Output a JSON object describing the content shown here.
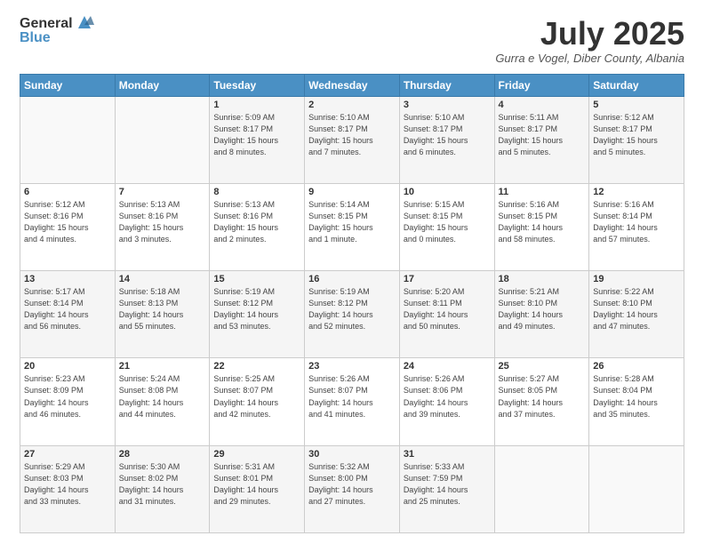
{
  "header": {
    "logo_general": "General",
    "logo_blue": "Blue",
    "month_title": "July 2025",
    "location": "Gurra e Vogel, Diber County, Albania"
  },
  "days_of_week": [
    "Sunday",
    "Monday",
    "Tuesday",
    "Wednesday",
    "Thursday",
    "Friday",
    "Saturday"
  ],
  "weeks": [
    [
      {
        "day": "",
        "info": ""
      },
      {
        "day": "",
        "info": ""
      },
      {
        "day": "1",
        "info": "Sunrise: 5:09 AM\nSunset: 8:17 PM\nDaylight: 15 hours\nand 8 minutes."
      },
      {
        "day": "2",
        "info": "Sunrise: 5:10 AM\nSunset: 8:17 PM\nDaylight: 15 hours\nand 7 minutes."
      },
      {
        "day": "3",
        "info": "Sunrise: 5:10 AM\nSunset: 8:17 PM\nDaylight: 15 hours\nand 6 minutes."
      },
      {
        "day": "4",
        "info": "Sunrise: 5:11 AM\nSunset: 8:17 PM\nDaylight: 15 hours\nand 5 minutes."
      },
      {
        "day": "5",
        "info": "Sunrise: 5:12 AM\nSunset: 8:17 PM\nDaylight: 15 hours\nand 5 minutes."
      }
    ],
    [
      {
        "day": "6",
        "info": "Sunrise: 5:12 AM\nSunset: 8:16 PM\nDaylight: 15 hours\nand 4 minutes."
      },
      {
        "day": "7",
        "info": "Sunrise: 5:13 AM\nSunset: 8:16 PM\nDaylight: 15 hours\nand 3 minutes."
      },
      {
        "day": "8",
        "info": "Sunrise: 5:13 AM\nSunset: 8:16 PM\nDaylight: 15 hours\nand 2 minutes."
      },
      {
        "day": "9",
        "info": "Sunrise: 5:14 AM\nSunset: 8:15 PM\nDaylight: 15 hours\nand 1 minute."
      },
      {
        "day": "10",
        "info": "Sunrise: 5:15 AM\nSunset: 8:15 PM\nDaylight: 15 hours\nand 0 minutes."
      },
      {
        "day": "11",
        "info": "Sunrise: 5:16 AM\nSunset: 8:15 PM\nDaylight: 14 hours\nand 58 minutes."
      },
      {
        "day": "12",
        "info": "Sunrise: 5:16 AM\nSunset: 8:14 PM\nDaylight: 14 hours\nand 57 minutes."
      }
    ],
    [
      {
        "day": "13",
        "info": "Sunrise: 5:17 AM\nSunset: 8:14 PM\nDaylight: 14 hours\nand 56 minutes."
      },
      {
        "day": "14",
        "info": "Sunrise: 5:18 AM\nSunset: 8:13 PM\nDaylight: 14 hours\nand 55 minutes."
      },
      {
        "day": "15",
        "info": "Sunrise: 5:19 AM\nSunset: 8:12 PM\nDaylight: 14 hours\nand 53 minutes."
      },
      {
        "day": "16",
        "info": "Sunrise: 5:19 AM\nSunset: 8:12 PM\nDaylight: 14 hours\nand 52 minutes."
      },
      {
        "day": "17",
        "info": "Sunrise: 5:20 AM\nSunset: 8:11 PM\nDaylight: 14 hours\nand 50 minutes."
      },
      {
        "day": "18",
        "info": "Sunrise: 5:21 AM\nSunset: 8:10 PM\nDaylight: 14 hours\nand 49 minutes."
      },
      {
        "day": "19",
        "info": "Sunrise: 5:22 AM\nSunset: 8:10 PM\nDaylight: 14 hours\nand 47 minutes."
      }
    ],
    [
      {
        "day": "20",
        "info": "Sunrise: 5:23 AM\nSunset: 8:09 PM\nDaylight: 14 hours\nand 46 minutes."
      },
      {
        "day": "21",
        "info": "Sunrise: 5:24 AM\nSunset: 8:08 PM\nDaylight: 14 hours\nand 44 minutes."
      },
      {
        "day": "22",
        "info": "Sunrise: 5:25 AM\nSunset: 8:07 PM\nDaylight: 14 hours\nand 42 minutes."
      },
      {
        "day": "23",
        "info": "Sunrise: 5:26 AM\nSunset: 8:07 PM\nDaylight: 14 hours\nand 41 minutes."
      },
      {
        "day": "24",
        "info": "Sunrise: 5:26 AM\nSunset: 8:06 PM\nDaylight: 14 hours\nand 39 minutes."
      },
      {
        "day": "25",
        "info": "Sunrise: 5:27 AM\nSunset: 8:05 PM\nDaylight: 14 hours\nand 37 minutes."
      },
      {
        "day": "26",
        "info": "Sunrise: 5:28 AM\nSunset: 8:04 PM\nDaylight: 14 hours\nand 35 minutes."
      }
    ],
    [
      {
        "day": "27",
        "info": "Sunrise: 5:29 AM\nSunset: 8:03 PM\nDaylight: 14 hours\nand 33 minutes."
      },
      {
        "day": "28",
        "info": "Sunrise: 5:30 AM\nSunset: 8:02 PM\nDaylight: 14 hours\nand 31 minutes."
      },
      {
        "day": "29",
        "info": "Sunrise: 5:31 AM\nSunset: 8:01 PM\nDaylight: 14 hours\nand 29 minutes."
      },
      {
        "day": "30",
        "info": "Sunrise: 5:32 AM\nSunset: 8:00 PM\nDaylight: 14 hours\nand 27 minutes."
      },
      {
        "day": "31",
        "info": "Sunrise: 5:33 AM\nSunset: 7:59 PM\nDaylight: 14 hours\nand 25 minutes."
      },
      {
        "day": "",
        "info": ""
      },
      {
        "day": "",
        "info": ""
      }
    ]
  ]
}
